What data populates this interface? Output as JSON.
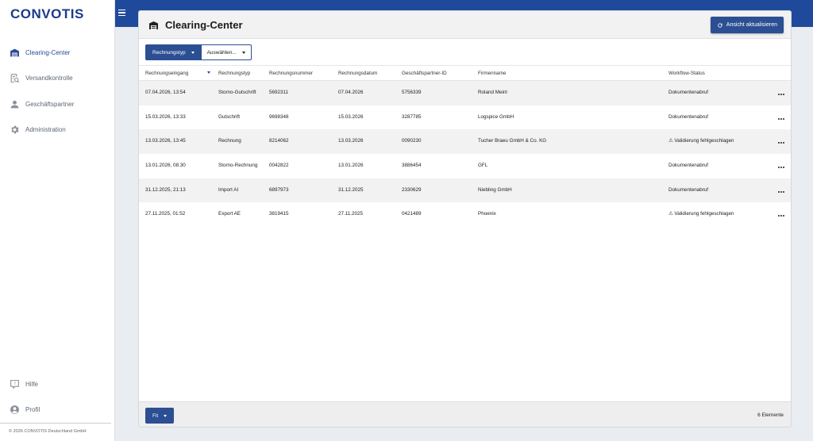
{
  "app": {
    "logo": "CONVOTIS",
    "copyright": "© 2026 CONVOTIS Deutschland GmbH"
  },
  "sidebar": {
    "items": [
      {
        "label": "Clearing-Center",
        "icon": "warehouse-icon"
      },
      {
        "label": "Versandkontrolle",
        "icon": "document-search-icon"
      },
      {
        "label": "Geschäftspartner",
        "icon": "person-icon"
      },
      {
        "label": "Administration",
        "icon": "gear-icon"
      }
    ],
    "bottom_items": [
      {
        "label": "Hilfe",
        "icon": "help-icon"
      },
      {
        "label": "Profil",
        "icon": "account-circle-icon"
      }
    ]
  },
  "page": {
    "title": "Clearing-Center",
    "refresh_label": "Ansicht aktualisieren",
    "filter_type_label": "Rechnungstyp",
    "filter_select_placeholder": "Auswählen...",
    "fit_label": "Fit",
    "count_label": "6 Elemente"
  },
  "table": {
    "columns": [
      "Rechnungseingang",
      "Rechnungstyp",
      "Rechnungsnummer",
      "Rechnungsdatum",
      "Geschäftspartner-ID",
      "Firmenname",
      "Workflow-Status"
    ],
    "rows": [
      [
        "07.04.2026, 13:54",
        "Storno-Gutschrift",
        "5692311",
        "07.04.2026",
        "5756339",
        "Roland Meinl",
        "Dokumentenabruf"
      ],
      [
        "15.03.2026, 13:33",
        "Gutschrift",
        "9698348",
        "15.03.2026",
        "3287785",
        "Logspice GmbH",
        "Dokumentenabruf"
      ],
      [
        "13.03.2026, 13:45",
        "Rechnung",
        "8214062",
        "13.03.2026",
        "0090230",
        "Tucher Braeu GmbH & Co. KG",
        "⚠ Validierung fehlgeschlagen"
      ],
      [
        "13.01.2026, 08:30",
        "Storno-Rechnung",
        "0042822",
        "13.01.2026",
        "3886454",
        "GFL",
        "Dokumentenabruf"
      ],
      [
        "31.12.2025, 21:13",
        "Import AI",
        "6897973",
        "31.12.2025",
        "2330629",
        "Niebling GmbH",
        "Dokumentenabruf"
      ],
      [
        "27.11.2025, 01:52",
        "Export AE",
        "3819415",
        "27.11.2025",
        "0421489",
        "Phoenix",
        "⚠ Validierung fehlgeschlagen"
      ]
    ]
  },
  "colors": {
    "brand": "#1f4a9b",
    "button": "#2c4f93",
    "row_alt": "#f2f2f3"
  }
}
